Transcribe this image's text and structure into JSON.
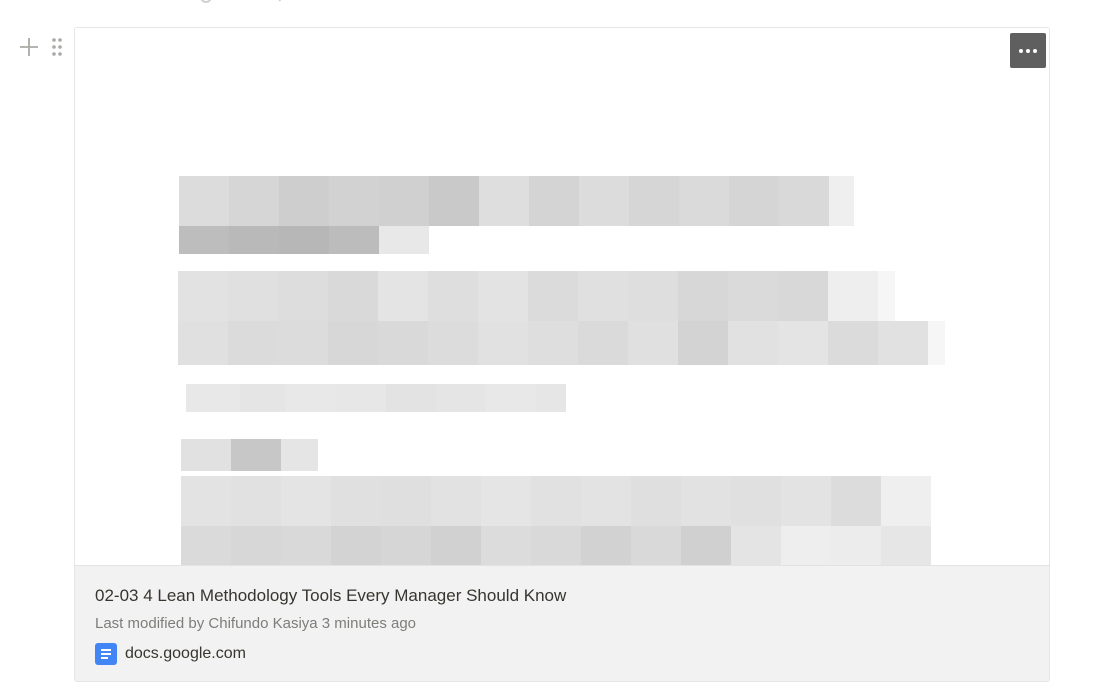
{
  "embed": {
    "title": "02-03 4 Lean Methodology Tools Every Manager Should Know",
    "meta": "Last modified by Chifundo Kasiya 3 minutes ago",
    "source": "docs.google.com",
    "source_icon": "google-docs-icon",
    "preview_state": "pixelated/blurred document preview",
    "colors": {
      "menu_button_bg": "#5f5f5f",
      "caption_bg": "#f2f2f2",
      "google_docs_blue": "#4285f4"
    }
  },
  "block_controls": {
    "add_icon": "plus-icon",
    "drag_icon": "drag-handle-icon",
    "menu_icon": "more-horizontal-icon"
  }
}
